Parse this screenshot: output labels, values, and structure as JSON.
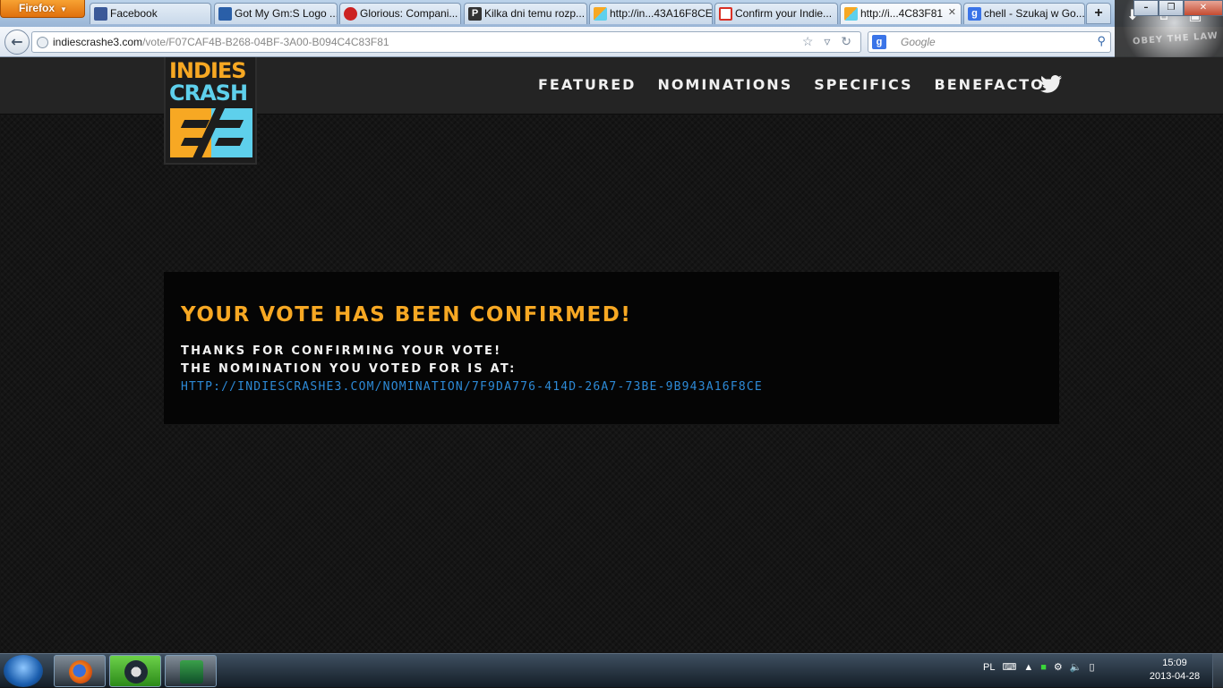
{
  "browser": {
    "app_button": "Firefox",
    "tabs": [
      {
        "label": "Facebook",
        "icon": "facebook-icon",
        "color": "#3b5998",
        "active": false
      },
      {
        "label": "Got My Gm:S Logo ...",
        "icon": "yoyo-icon",
        "color": "#2a5fa8",
        "active": false
      },
      {
        "label": "Glorious: Compani...",
        "icon": "red-circle-icon",
        "color": "#cc2222",
        "active": false
      },
      {
        "label": "Kilka dni temu rozp...",
        "icon": "p-icon",
        "color": "#333333",
        "active": false
      },
      {
        "label": "http://in...43A16F8CE",
        "icon": "indiescrash-icon",
        "color": "#f7a823",
        "active": false
      },
      {
        "label": "Confirm your Indie...",
        "icon": "gmail-icon",
        "color": "#d93025",
        "active": false
      },
      {
        "label": "http://i...4C83F81",
        "icon": "indiescrash-icon",
        "color": "#f7a823",
        "active": true
      },
      {
        "label": "chell - Szukaj w Go...",
        "icon": "google-icon",
        "color": "#3a74e8",
        "active": false
      }
    ],
    "url_domain": "indiescrashe3.com",
    "url_path": "/vote/F07CAF4B-B268-04BF-3A00-B094C4C83F81",
    "search_placeholder": "Google",
    "search_engine_letter": "g",
    "persona_text": "OBEY THE LAW"
  },
  "site": {
    "logo": {
      "line1": "INDIES",
      "line2": "CRASH",
      "colors": {
        "orange": "#f7a823",
        "cyan": "#5ed0ec"
      }
    },
    "nav": [
      "FEATURED",
      "NOMINATIONS",
      "SPECIFICS",
      "BENEFACTOR"
    ],
    "confirm": {
      "title": "YOUR VOTE HAS BEEN CONFIRMED!",
      "line1": "THANKS FOR CONFIRMING YOUR VOTE!",
      "line2": "THE NOMINATION YOU VOTED FOR IS AT:",
      "link": "HTTP://INDIESCRASHE3.COM/NOMINATION/7F9DA776-414D-26A7-73BE-9B943A16F8CE"
    }
  },
  "taskbar": {
    "language": "PL",
    "time": "15:09",
    "date": "2013-04-28"
  }
}
